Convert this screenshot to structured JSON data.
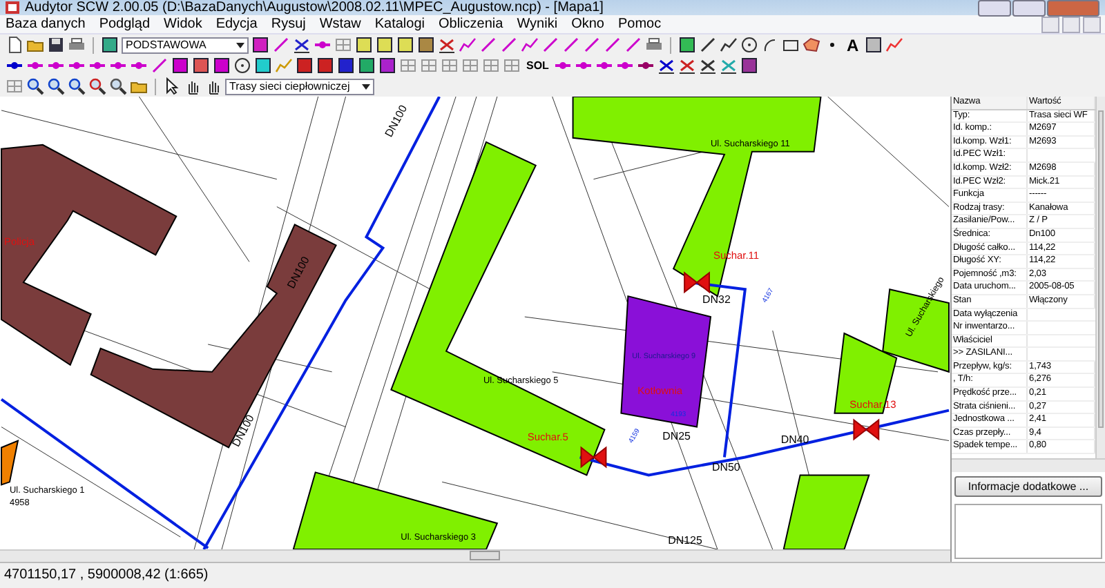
{
  "window": {
    "title": "Audytor SCW  2.00.05   (D:\\BazaDanych\\Augustow\\2008.02.11\\MPEC_Augustow.ncp) - [Mapa1]"
  },
  "menu": [
    "Baza danych",
    "Podgląd",
    "Widok",
    "Edycja",
    "Rysuj",
    "Wstaw",
    "Katalogi",
    "Obliczenia",
    "Wyniki",
    "Okno",
    "Pomoc"
  ],
  "toolbar": {
    "layer_select": "PODSTAWOWA",
    "sol_button": "SOL",
    "text_tool": "A",
    "network_select": "Trasy sieci ciepłowniczej"
  },
  "map_labels": [
    {
      "kind": "pipe",
      "text": "DN100"
    },
    {
      "kind": "street",
      "text": "Ul. Sucharskiego 11"
    },
    {
      "kind": "object",
      "text": "Policja"
    },
    {
      "kind": "object",
      "text": "Suchar.11"
    },
    {
      "kind": "pipe",
      "text": "DN100"
    },
    {
      "kind": "pipe",
      "text": "DN32"
    },
    {
      "kind": "node",
      "text": "4167"
    },
    {
      "kind": "street",
      "text": "Ul. Sucharskiego"
    },
    {
      "kind": "inner",
      "text": "Ul. Sucharskiego 9"
    },
    {
      "kind": "street",
      "text": "Ul. Sucharskiego 5"
    },
    {
      "kind": "object",
      "text": "Kotłownia"
    },
    {
      "kind": "object",
      "text": "Suchar.13"
    },
    {
      "kind": "node",
      "text": "4193"
    },
    {
      "kind": "object",
      "text": "Suchar.5"
    },
    {
      "kind": "pipe",
      "text": "DN25"
    },
    {
      "kind": "node",
      "text": "4159"
    },
    {
      "kind": "pipe",
      "text": "DN40"
    },
    {
      "kind": "pipe",
      "text": "DN100"
    },
    {
      "kind": "pipe",
      "text": "DN50"
    },
    {
      "kind": "street",
      "text": "Ul. Sucharskiego 1"
    },
    {
      "kind": "street",
      "text": "4958"
    },
    {
      "kind": "street",
      "text": "Ul. Sucharskiego 3"
    },
    {
      "kind": "pipe",
      "text": "DN125"
    }
  ],
  "properties": {
    "columns": [
      "Nazwa",
      "Wartość"
    ],
    "rows": [
      {
        "name": "Typ:",
        "value": "Trasa sieci WF"
      },
      {
        "name": "Id. komp.:",
        "value": "M2697"
      },
      {
        "name": "Id.komp. Wzł1:",
        "value": "M2693"
      },
      {
        "name": "Id.PEC Wzł1:",
        "value": ""
      },
      {
        "name": "Id.komp. Wzł2:",
        "value": "M2698"
      },
      {
        "name": "Id.PEC Wzł2:",
        "value": "Mick.21"
      },
      {
        "name": "Funkcja",
        "value": "------"
      },
      {
        "name": "Rodzaj trasy:",
        "value": "Kanałowa"
      },
      {
        "name": "Zasilanie/Pow...",
        "value": "Z / P"
      },
      {
        "name": "Średnica:",
        "value": "Dn100"
      },
      {
        "name": "Długość całko...",
        "value": "114,22"
      },
      {
        "name": "Długość XY:",
        "value": "114,22"
      },
      {
        "name": "Pojemność ,m3:",
        "value": "2,03"
      },
      {
        "name": "Data uruchom...",
        "value": "2005-08-05"
      },
      {
        "name": "Stan",
        "value": "Włączony"
      },
      {
        "name": "Data wyłączenia",
        "value": ""
      },
      {
        "name": "Nr inwentarzo...",
        "value": ""
      },
      {
        "name": "Właściciel",
        "value": ""
      },
      {
        "name": ">> ZASILANI...",
        "value": ""
      },
      {
        "name": "Przepływ, kg/s:",
        "value": "1,743"
      },
      {
        "name": "      , T/h:",
        "value": "6,276"
      },
      {
        "name": "Prędkość prze...",
        "value": "0,21"
      },
      {
        "name": "Strata ciśnieni...",
        "value": "0,27"
      },
      {
        "name": "Jednostkowa ...",
        "value": "2,41"
      },
      {
        "name": "Czas przepły...",
        "value": "9,4"
      },
      {
        "name": "Spadek tempe...",
        "value": "0,80"
      }
    ],
    "details_button": "Informacje dodatkowe ..."
  },
  "status_bar": {
    "coordinates": "4701150,17 , 5900008,42  (1:665)"
  }
}
